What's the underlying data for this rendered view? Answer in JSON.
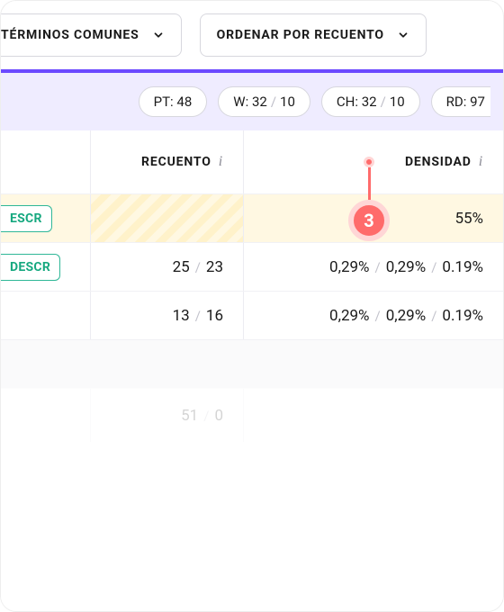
{
  "filters": {
    "left_label": "TÉRMINOS COMUNES",
    "right_label": "ORDENAR POR RECUENTO"
  },
  "chips": {
    "pt": {
      "label": "PT",
      "value": "48"
    },
    "w": {
      "label": "W",
      "a": "32",
      "b": "10"
    },
    "ch": {
      "label": "CH",
      "a": "32",
      "b": "10"
    },
    "rd": {
      "label": "RD",
      "value": "97"
    }
  },
  "columns": {
    "recuento": "RECUENTO",
    "densidad": "DENSIDAD"
  },
  "rows": [
    {
      "badge": "ESCR",
      "count_a": "",
      "count_b": "",
      "density_single": "55%",
      "highlight": true
    },
    {
      "badge": "DESCR",
      "count_a": "25",
      "count_b": "23",
      "density": [
        "0,29%",
        "0,29%",
        "0.19%"
      ]
    },
    {
      "badge": "",
      "count_a": "13",
      "count_b": "16",
      "density": [
        "0,29%",
        "0,29%",
        "0.19%"
      ]
    }
  ],
  "faded_row": {
    "count_a": "51",
    "count_b": "0"
  },
  "callout": {
    "number": "3"
  }
}
